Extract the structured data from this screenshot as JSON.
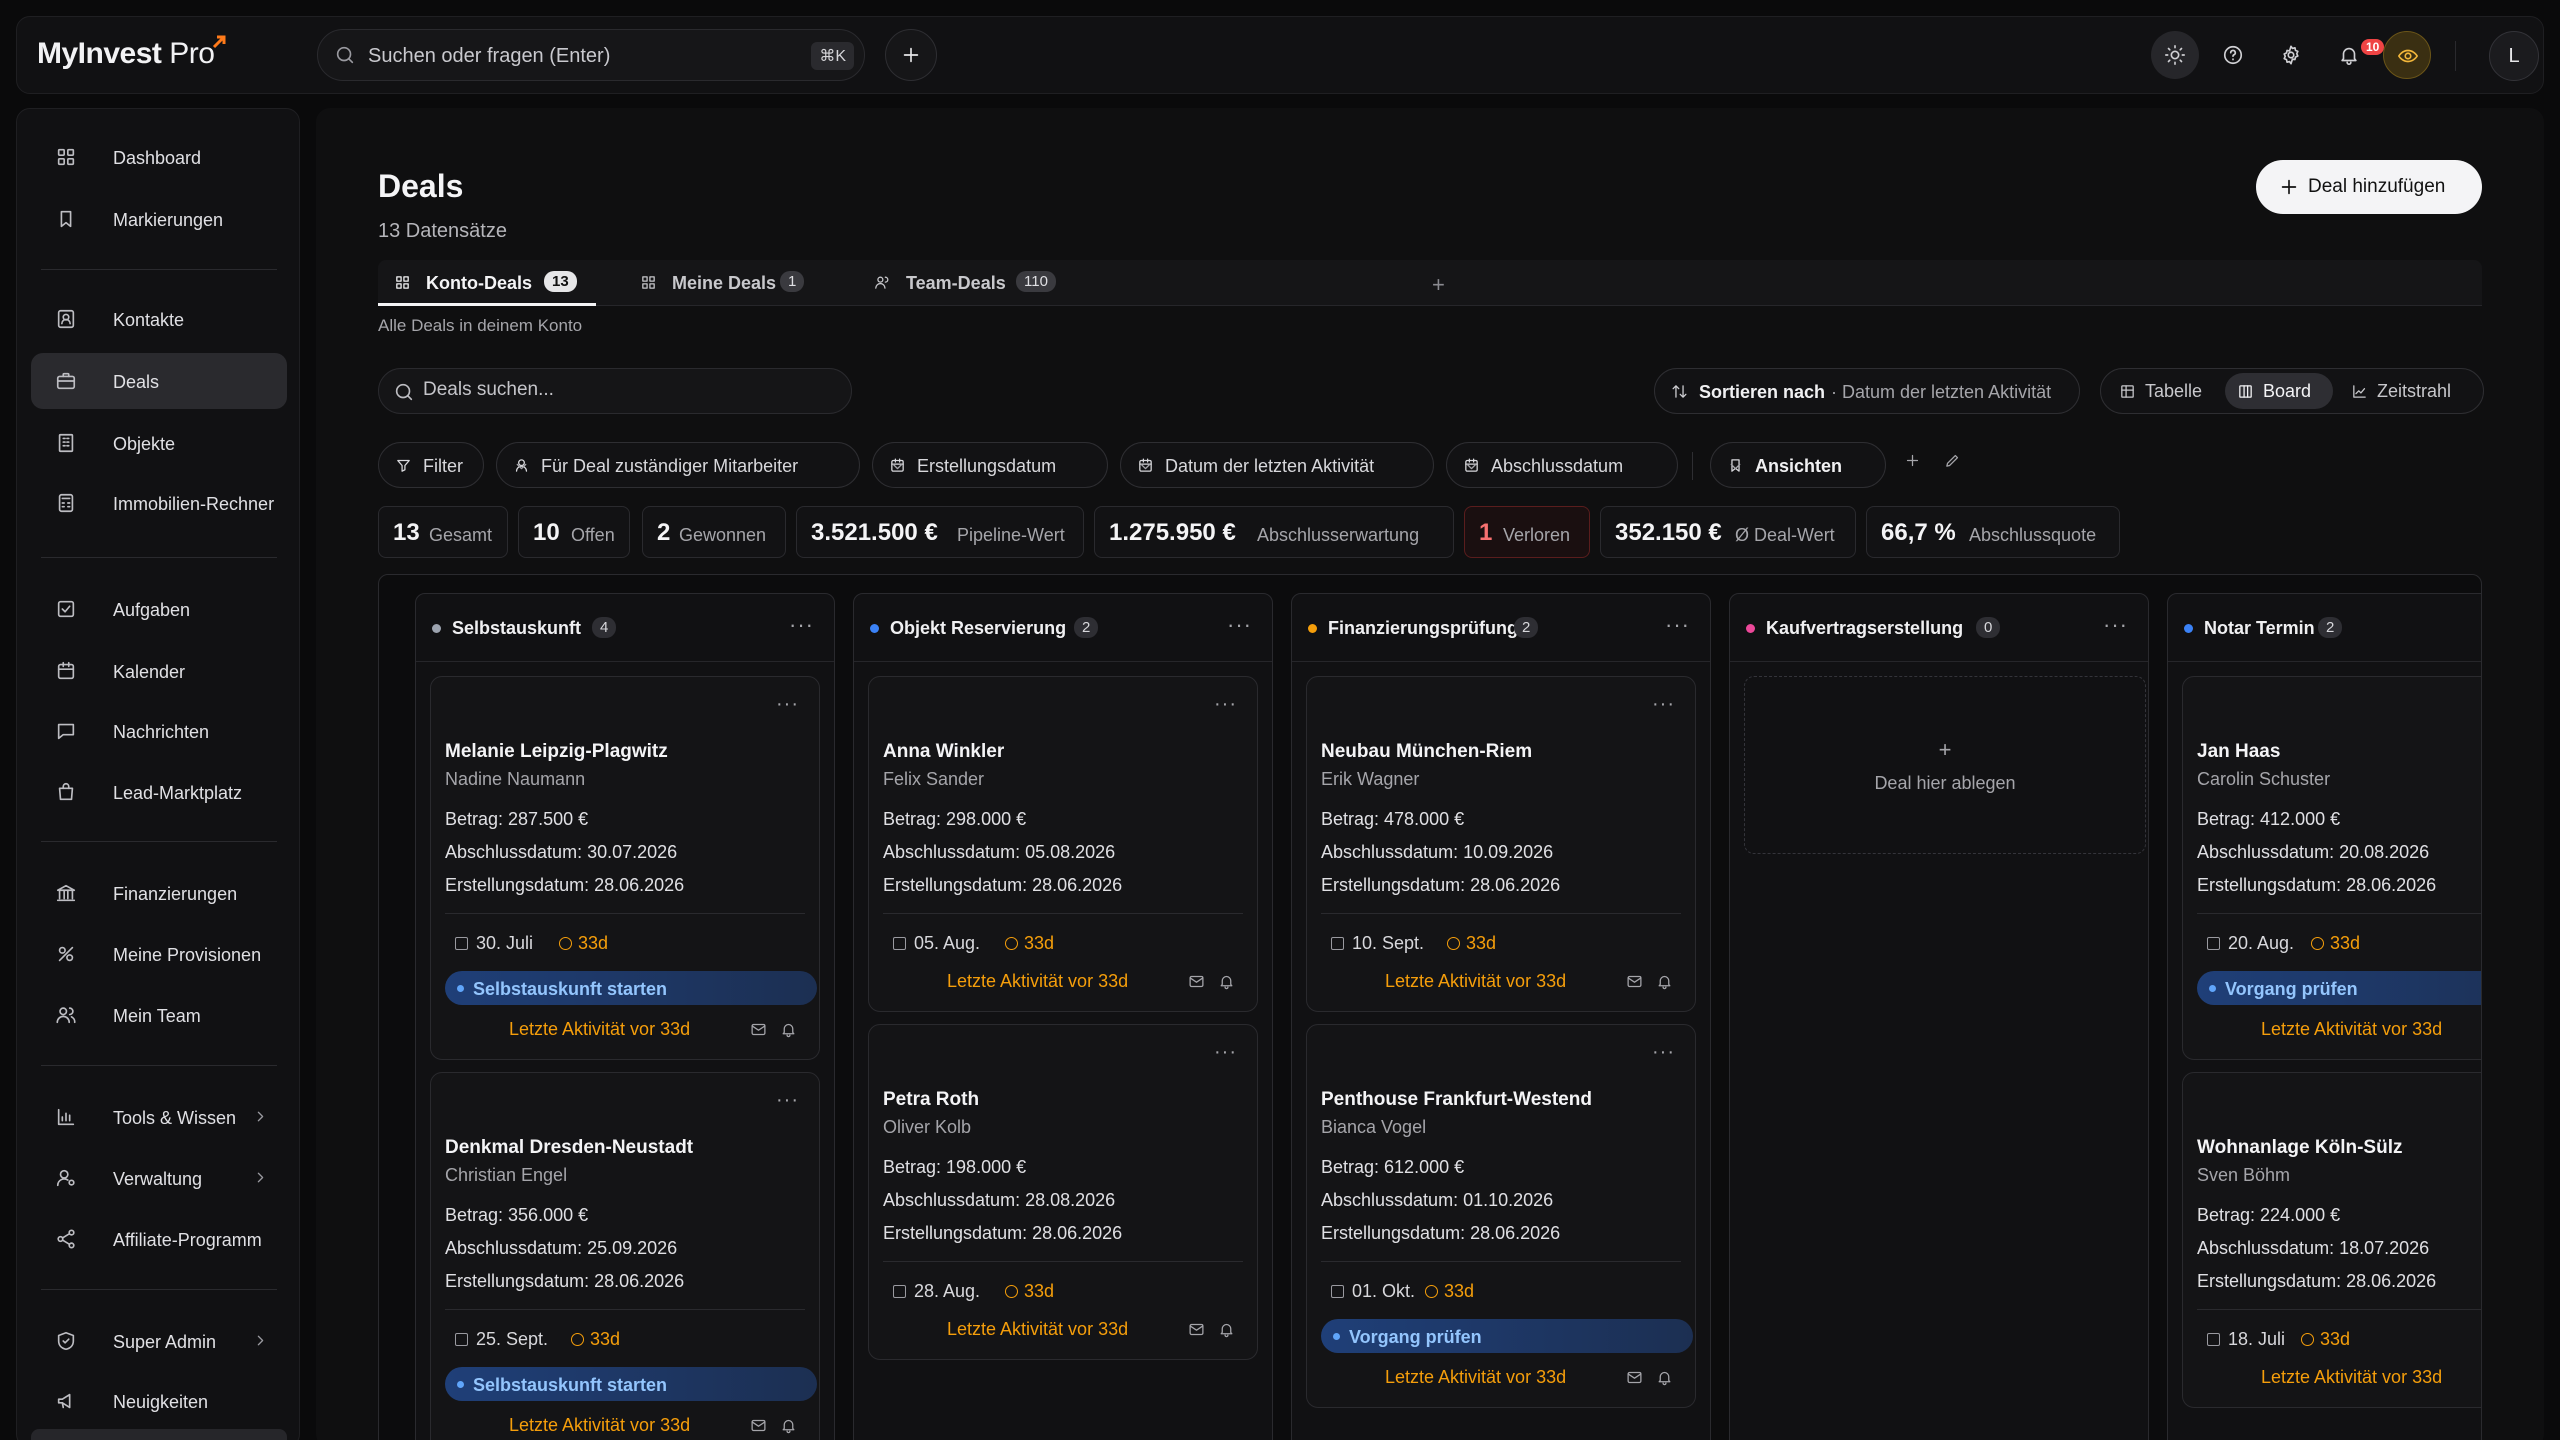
{
  "app": {
    "logo": "MyInvest",
    "logo_suffix": "Pro",
    "search_placeholder": "Suchen oder fragen (Enter)",
    "search_shortcut": "⌘K",
    "notification_count": "10",
    "avatar_initial": "L"
  },
  "sidebar": {
    "items": [
      {
        "label": "Dashboard",
        "icon": "grid-icon"
      },
      {
        "label": "Markierungen",
        "icon": "bookmark-icon"
      },
      {
        "label": "Kontakte",
        "icon": "contact-icon"
      },
      {
        "label": "Deals",
        "icon": "briefcase-icon",
        "active": true
      },
      {
        "label": "Objekte",
        "icon": "building-icon"
      },
      {
        "label": "Immobilien-Rechner",
        "icon": "calculator-icon"
      },
      {
        "label": "Aufgaben",
        "icon": "check-square-icon"
      },
      {
        "label": "Kalender",
        "icon": "calendar-icon"
      },
      {
        "label": "Nachrichten",
        "icon": "message-icon"
      },
      {
        "label": "Lead-Marktplatz",
        "icon": "shopping-bag-icon"
      },
      {
        "label": "Finanzierungen",
        "icon": "bank-icon"
      },
      {
        "label": "Meine Provisionen",
        "icon": "percent-icon"
      },
      {
        "label": "Mein Team",
        "icon": "users-icon"
      },
      {
        "label": "Tools & Wissen",
        "icon": "chart-icon",
        "has_children": true
      },
      {
        "label": "Verwaltung",
        "icon": "user-cog-icon",
        "has_children": true
      },
      {
        "label": "Affiliate-Programm",
        "icon": "share-icon"
      },
      {
        "label": "Super Admin",
        "icon": "shield-icon",
        "has_children": true
      },
      {
        "label": "Neuigkeiten",
        "icon": "megaphone-icon"
      }
    ]
  },
  "page": {
    "title": "Deals",
    "record_count": "13 Datensätze",
    "add_button": "Deal hinzufügen",
    "tab_description": "Alle Deals in deinem Konto",
    "search_placeholder": "Deals suchen..."
  },
  "tabs": [
    {
      "label": "Konto-Deals",
      "count": "13",
      "active": true
    },
    {
      "label": "Meine Deals",
      "count": "1"
    },
    {
      "label": "Team-Deals",
      "count": "110"
    }
  ],
  "sort": {
    "label": "Sortieren nach",
    "value": "· Datum der letzten Aktivität"
  },
  "views": [
    {
      "label": "Tabelle"
    },
    {
      "label": "Board",
      "active": true
    },
    {
      "label": "Zeitstrahl"
    }
  ],
  "filters": {
    "filter": "Filter",
    "owner": "Für Deal zuständiger Mitarbeiter",
    "created": "Erstellungsdatum",
    "last_activity": "Datum der letzten Aktivität",
    "close_date": "Abschlussdatum",
    "views": "Ansichten"
  },
  "stats": [
    {
      "num": "13",
      "label": "Gesamt"
    },
    {
      "num": "10",
      "label": "Offen"
    },
    {
      "num": "2",
      "label": "Gewonnen"
    },
    {
      "num": "3.521.500 €",
      "label": "Pipeline-Wert"
    },
    {
      "num": "1.275.950 €",
      "label": "Abschlusserwartung"
    },
    {
      "num": "1",
      "label": "Verloren"
    },
    {
      "num": "352.150 €",
      "label": "Ø Deal-Wert"
    },
    {
      "num": "66,7 %",
      "label": "Abschlussquote"
    }
  ],
  "columns": [
    {
      "name": "Selbstauskunft",
      "count": "4",
      "color": "#9ca3af",
      "cards": [
        {
          "title": "Melanie Leipzig-Plagwitz",
          "owner": "Nadine Naumann",
          "amount": "Betrag: 287.500 €",
          "close": "Abschlussdatum: 30.07.2026",
          "created": "Erstellungsdatum: 28.06.2026",
          "date": "30. Juli",
          "age": "33d",
          "stage_action": "Selbstauskunft starten",
          "activity": "Letzte Aktivität vor 33d"
        },
        {
          "title": "Denkmal Dresden-Neustadt",
          "owner": "Christian Engel",
          "amount": "Betrag: 356.000 €",
          "close": "Abschlussdatum: 25.09.2026",
          "created": "Erstellungsdatum: 28.06.2026",
          "date": "25. Sept.",
          "age": "33d",
          "stage_action": "Selbstauskunft starten",
          "activity": "Letzte Aktivität vor 33d"
        }
      ]
    },
    {
      "name": "Objekt Reservierung",
      "count": "2",
      "color": "#3b82f6",
      "cards": [
        {
          "title": "Anna Winkler",
          "owner": "Felix Sander",
          "amount": "Betrag: 298.000 €",
          "close": "Abschlussdatum: 05.08.2026",
          "created": "Erstellungsdatum: 28.06.2026",
          "date": "05. Aug.",
          "age": "33d",
          "activity": "Letzte Aktivität vor 33d"
        },
        {
          "title": "Petra Roth",
          "owner": "Oliver Kolb",
          "amount": "Betrag: 198.000 €",
          "close": "Abschlussdatum: 28.08.2026",
          "created": "Erstellungsdatum: 28.06.2026",
          "date": "28. Aug.",
          "age": "33d",
          "activity": "Letzte Aktivität vor 33d"
        }
      ]
    },
    {
      "name": "Finanzierungsprüfung",
      "count": "2",
      "color": "#f59e0b",
      "cards": [
        {
          "title": "Neubau München-Riem",
          "owner": "Erik Wagner",
          "amount": "Betrag: 478.000 €",
          "close": "Abschlussdatum: 10.09.2026",
          "created": "Erstellungsdatum: 28.06.2026",
          "date": "10. Sept.",
          "age": "33d",
          "activity": "Letzte Aktivität vor 33d"
        },
        {
          "title": "Penthouse Frankfurt-Westend",
          "owner": "Bianca Vogel",
          "amount": "Betrag: 612.000 €",
          "close": "Abschlussdatum: 01.10.2026",
          "created": "Erstellungsdatum: 28.06.2026",
          "date": "01. Okt.",
          "age": "33d",
          "stage_action": "Vorgang prüfen",
          "activity": "Letzte Aktivität vor 33d"
        }
      ]
    },
    {
      "name": "Kaufvertragserstellung",
      "count": "0",
      "color": "#ec4899",
      "dropzone": {
        "plus": "+",
        "label": "Deal hier ablegen"
      },
      "cards": []
    },
    {
      "name": "Notar Termin",
      "count": "2",
      "color": "#3b82f6",
      "cards": [
        {
          "title": "Jan Haas",
          "owner": "Carolin Schuster",
          "amount": "Betrag: 412.000 €",
          "close": "Abschlussdatum: 20.08.2026",
          "created": "Erstellungsdatum: 28.06.2026",
          "date": "20. Aug.",
          "age": "33d",
          "stage_action": "Vorgang prüfen",
          "activity": "Letzte Aktivität vor 33d"
        },
        {
          "title": "Wohnanlage Köln-Sülz",
          "owner": "Sven Böhm",
          "amount": "Betrag: 224.000 €",
          "close": "Abschlussdatum: 18.07.2026",
          "created": "Erstellungsdatum: 28.06.2026",
          "date": "18. Juli",
          "age": "33d",
          "activity": "Letzte Aktivität vor 33d"
        }
      ]
    }
  ]
}
